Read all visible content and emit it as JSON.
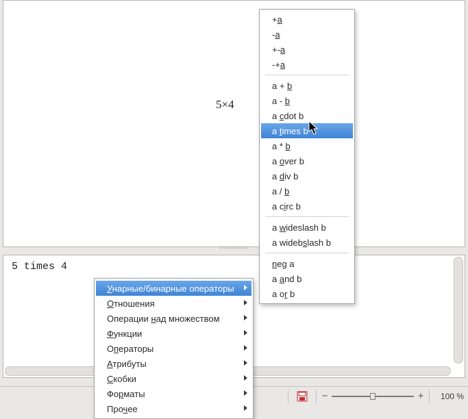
{
  "preview": {
    "formula_rendered": "5×4"
  },
  "editor": {
    "code": "5 times 4"
  },
  "status": {
    "zoom_label": "100 %"
  },
  "context_menu": {
    "items": [
      {
        "pre": "",
        "ul": "У",
        "post": "нарные/бинарные операторы",
        "highlight": true,
        "arrow": true
      },
      {
        "pre": "",
        "ul": "О",
        "post": "тношения",
        "arrow": true
      },
      {
        "pre": "Операции ",
        "ul": "н",
        "post": "ад множеством",
        "arrow": true
      },
      {
        "pre": "",
        "ul": "Ф",
        "post": "ункции",
        "arrow": true
      },
      {
        "pre": "О",
        "ul": "п",
        "post": "ераторы",
        "arrow": true
      },
      {
        "pre": "",
        "ul": "А",
        "post": "трибуты",
        "arrow": true
      },
      {
        "pre": "",
        "ul": "С",
        "post": "кобки",
        "arrow": true
      },
      {
        "pre": "Фо",
        "ul": "р",
        "post": "маты",
        "arrow": true
      },
      {
        "pre": "Про",
        "ul": "ч",
        "post": "ее",
        "arrow": true
      }
    ]
  },
  "sub_menu": {
    "groups": [
      [
        {
          "pre": "+",
          "ul": "a",
          "post": ""
        },
        {
          "pre": "-",
          "ul": "a",
          "post": ""
        },
        {
          "pre": "+-",
          "ul": "a",
          "post": ""
        },
        {
          "pre": "-+",
          "ul": "a",
          "post": ""
        }
      ],
      [
        {
          "pre": "a + ",
          "ul": "b",
          "post": ""
        },
        {
          "pre": "a - ",
          "ul": "b",
          "post": ""
        },
        {
          "pre": "a ",
          "ul": "c",
          "post": "dot b"
        },
        {
          "pre": "a ",
          "ul": "t",
          "post": "imes b",
          "highlight": true
        },
        {
          "pre": "a * ",
          "ul": "b",
          "post": ""
        },
        {
          "pre": "a ",
          "ul": "o",
          "post": "ver b"
        },
        {
          "pre": "a ",
          "ul": "d",
          "post": "iv b"
        },
        {
          "pre": "a / ",
          "ul": "b",
          "post": ""
        },
        {
          "pre": "a c",
          "ul": "i",
          "post": "rc b"
        }
      ],
      [
        {
          "pre": "a ",
          "ul": "w",
          "post": "ideslash b"
        },
        {
          "pre": "a wideb",
          "ul": "s",
          "post": "lash b"
        }
      ],
      [
        {
          "pre": "",
          "ul": "n",
          "post": "eg a"
        },
        {
          "pre": "a ",
          "ul": "a",
          "post": "nd b"
        },
        {
          "pre": "a o",
          "ul": "r",
          "post": " b"
        }
      ]
    ]
  }
}
